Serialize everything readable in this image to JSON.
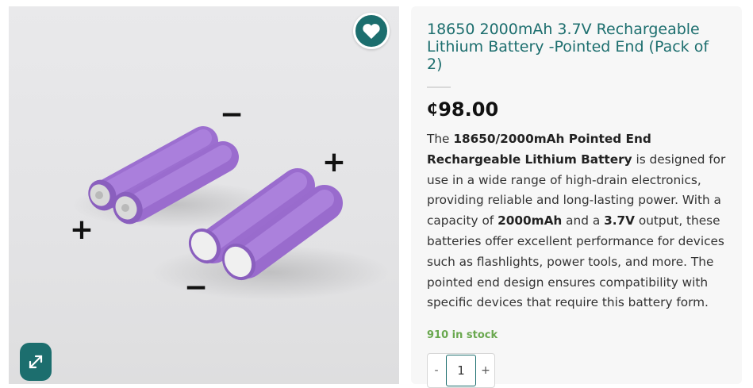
{
  "product": {
    "title": "18650 2000mAh 3.7V Rechargeable Lithium Battery -Pointed End (Pack of 2)",
    "currency_symbol": "₵",
    "price": "98.00",
    "description": {
      "p1": "The ",
      "b1": "18650/2000mAh Pointed End Rechargeable Lithium Battery",
      "p2": " is designed for use in a wide range of high-drain electronics, providing reliable and long-lasting power. With a capacity of ",
      "b2": "2000mAh",
      "p3": " and a ",
      "b3": "3.7V",
      "p4": " output, these batteries offer excellent performance for devices such as flashlights, power tools, and more. The pointed end design ensures compatibility with specific devices that require this battery form."
    },
    "stock": "910 in stock",
    "quantity": {
      "value": "1",
      "decrement_label": "-",
      "increment_label": "+"
    }
  },
  "gallery": {
    "wishlist_icon": "heart-icon",
    "zoom_icon": "expand-icon",
    "polarity_labels": {
      "minus": "−",
      "plus": "+"
    },
    "colors": {
      "accent": "#1c6e6e",
      "battery": "#a878d8"
    }
  }
}
